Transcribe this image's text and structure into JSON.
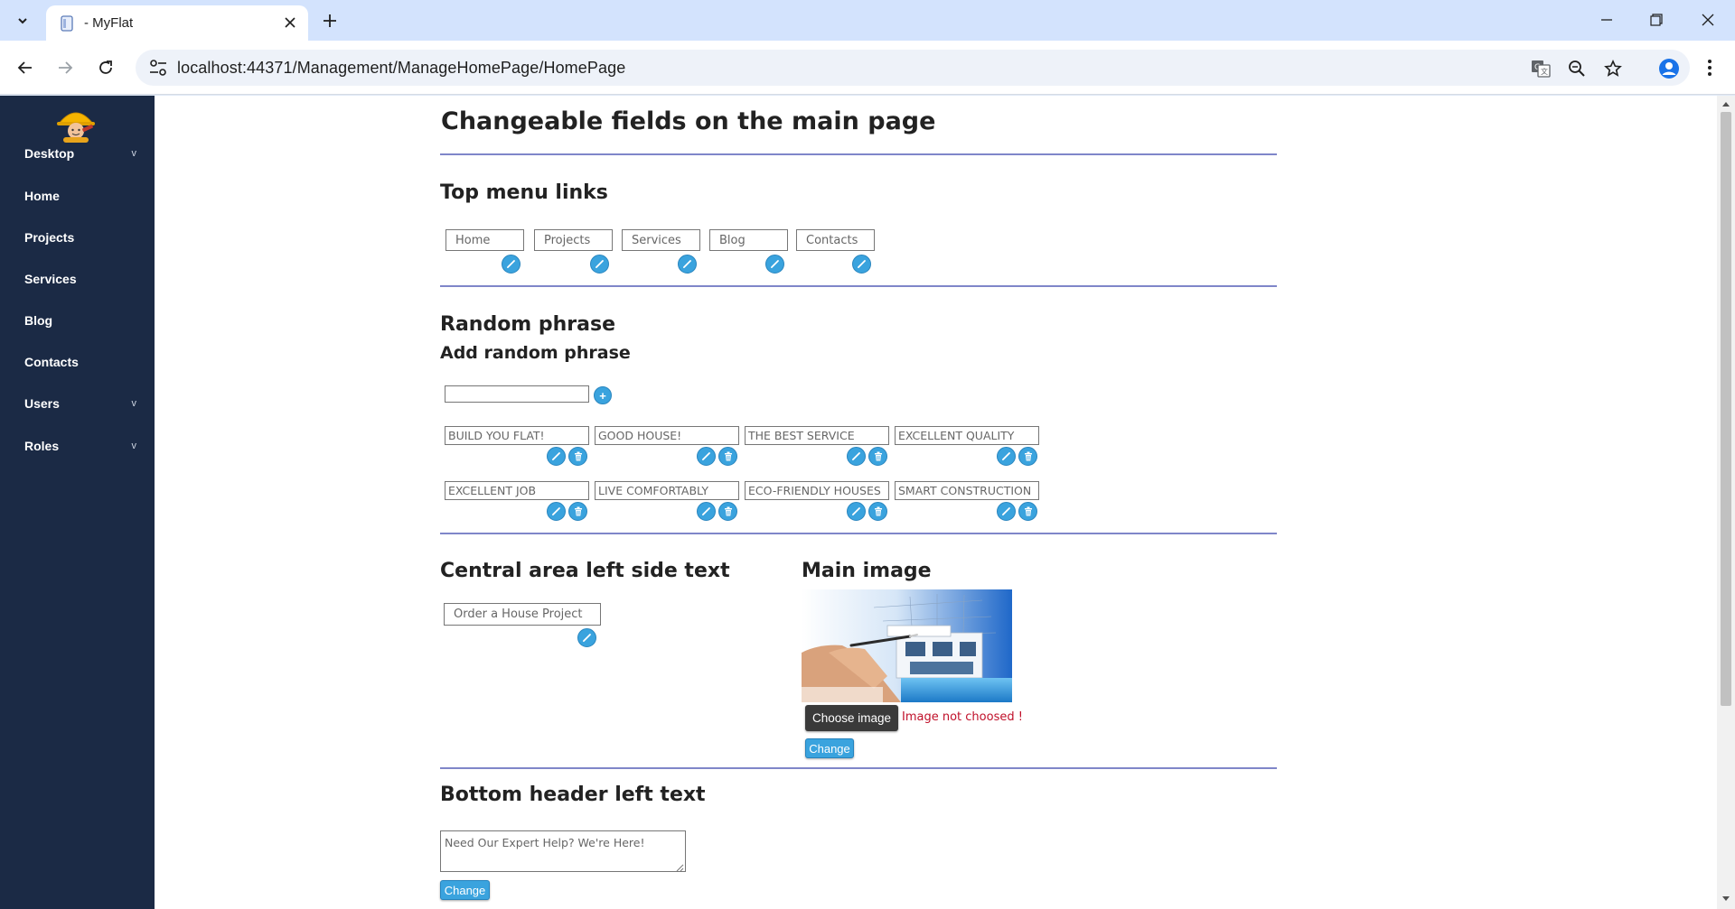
{
  "browser": {
    "tab_title": "- MyFlat",
    "url": "localhost:44371/Management/ManageHomePage/HomePage"
  },
  "sidebar": {
    "items": [
      {
        "label": "Desktop",
        "chevron": "v"
      },
      {
        "label": "Home"
      },
      {
        "label": "Projects"
      },
      {
        "label": "Services"
      },
      {
        "label": "Blog"
      },
      {
        "label": "Contacts"
      },
      {
        "label": "Users",
        "chevron": "v"
      },
      {
        "label": "Roles",
        "chevron": "v"
      }
    ]
  },
  "page": {
    "title": "Changeable fields on the main page",
    "top_menu": {
      "heading": "Top menu links",
      "links": [
        "Home",
        "Projects",
        "Services",
        "Blog",
        "Contacts"
      ]
    },
    "random_phrase": {
      "heading": "Random phrase",
      "add_heading": "Add random phrase",
      "new_value": "",
      "add_icon": "+",
      "phrases": [
        "BUILD YOU FLAT!",
        "GOOD HOUSE!",
        "THE BEST SERVICE",
        "EXCELLENT QUALITY",
        "EXCELLENT JOB",
        "LIVE COMFORTABLY",
        "ECO-FRIENDLY HOUSES",
        "SMART CONSTRUCTION"
      ]
    },
    "central": {
      "heading": "Central area left side text",
      "value": "Order a House Project"
    },
    "main_image": {
      "heading": "Main image",
      "choose_label": "Choose image",
      "status": "Image not choosed !",
      "change_label": "Change"
    },
    "bottom_header": {
      "heading": "Bottom header left text",
      "value": "Need Our Expert Help? We're Here!",
      "change_label": "Change"
    }
  },
  "colors": {
    "sidebar_bg": "#1b2a45",
    "accent": "#3aa3de",
    "divider": "#7f86c9",
    "error": "#c0102a"
  }
}
